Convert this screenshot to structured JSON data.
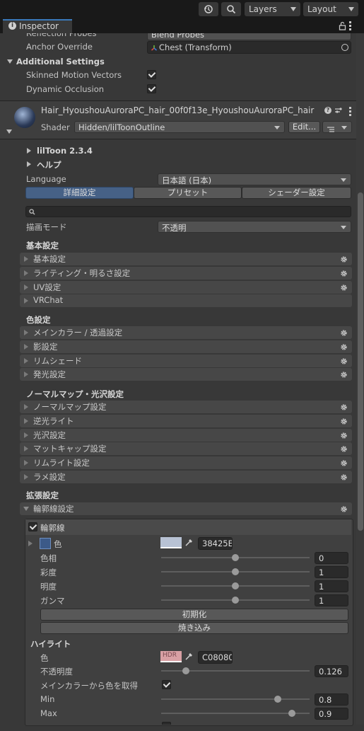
{
  "toolbar": {
    "layers_label": "Layers",
    "layout_label": "Layout"
  },
  "tab": {
    "label": "Inspector"
  },
  "renderer": {
    "reflection_probes_label": "Reflection Probes",
    "reflection_probes_value": "Blend Probes",
    "anchor_override_label": "Anchor Override",
    "anchor_override_value": "Chest (Transform)",
    "additional_settings_label": "Additional Settings",
    "skinned_motion_vectors_label": "Skinned Motion Vectors",
    "dynamic_occlusion_label": "Dynamic Occlusion"
  },
  "material": {
    "name": "Hair_HyoushouAuroraPC_hair_00f0f13e_HyoushouAuroraPC_hair",
    "shader_label": "Shader",
    "shader_value": "Hidden/lilToonOutline",
    "edit_label": "Edit..."
  },
  "liltoon": {
    "version": "lilToon 2.3.4",
    "help": "ヘルプ",
    "language_label": "Language",
    "language_value": "日本語 (日本)",
    "tabs": [
      "詳細設定",
      "プリセット",
      "シェーダー設定"
    ],
    "render_mode_label": "描画モード",
    "render_mode_value": "不透明"
  },
  "groups": {
    "basic": {
      "title": "基本設定",
      "items": [
        "基本設定",
        "ライティング・明るさ設定",
        "UV設定",
        "VRChat"
      ]
    },
    "color": {
      "title": "色設定",
      "items": [
        "メインカラー / 透過設定",
        "影設定",
        "リムシェード",
        "発光設定"
      ]
    },
    "normal": {
      "title": "ノーマルマップ・光沢設定",
      "items": [
        "ノーマルマップ設定",
        "逆光ライト",
        "光沢設定",
        "マットキャップ設定",
        "リムライト設定",
        "ラメ設定"
      ]
    },
    "extended": {
      "title": "拡張設定",
      "items": [
        "輪郭線設定"
      ]
    }
  },
  "outline": {
    "enable_label": "輪郭線",
    "color_label": "色",
    "color_hex": "38425E",
    "swatch_color": "#b8c2d4",
    "hue_label": "色相",
    "hue_value": "0",
    "hue_fraction": 0.5,
    "saturation_label": "彩度",
    "saturation_value": "1",
    "saturation_fraction": 0.5,
    "brightness_label": "明度",
    "brightness_value": "1",
    "brightness_fraction": 0.5,
    "gamma_label": "ガンマ",
    "gamma_value": "1",
    "gamma_fraction": 0.5,
    "reset_label": "初期化",
    "bake_label": "焼き込み"
  },
  "highlight": {
    "title": "ハイライト",
    "color_label": "色",
    "hdr_label": "HDR",
    "color_hex": "C08080",
    "swatch_color": "#d8a0a4",
    "opacity_label": "不透明度",
    "opacity_value": "0.126",
    "opacity_fraction": 0.15,
    "maincolor_label": "メインカラーから色を取得",
    "min_label": "Min",
    "min_value": "0.8",
    "min_fraction": 0.8,
    "max_label": "Max",
    "max_value": "0.9",
    "max_fraction": 0.9
  },
  "colors": {
    "accent": "#3a79bb",
    "panel": "#383838",
    "dark": "#191919"
  }
}
